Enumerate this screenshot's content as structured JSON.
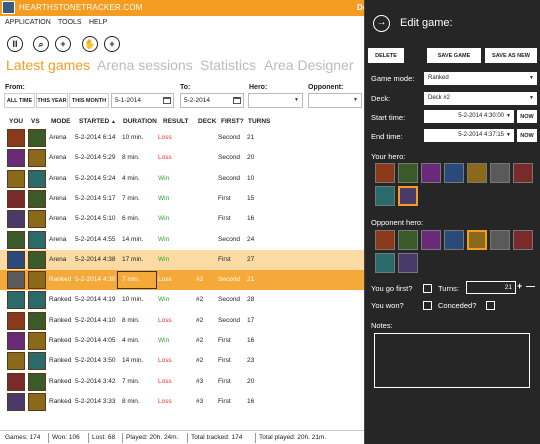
{
  "app": {
    "title": "HEARTHSTONETRACKER.COM",
    "donate": "Donate",
    "icon": "hearthstone-logo"
  },
  "titlebar_buttons": [
    "gear-icon",
    "notification-icon",
    "info-icon",
    "minimize-icon",
    "maximize-icon",
    "close-icon"
  ],
  "menu": [
    "APPLICATION",
    "TOOLS",
    "HELP"
  ],
  "toolbar": [
    "pause-icon",
    "search-icon",
    "add-icon",
    "glove-icon",
    "add-icon"
  ],
  "tabs": [
    "Latest games",
    "Arena sessions",
    "Statistics",
    "Area Designer"
  ],
  "filters": {
    "from_label": "From:",
    "to_label": "To:",
    "hero_label": "Hero:",
    "opponent_label": "Opponent:",
    "all_time": "ALL TIME",
    "this_year": "THIS YEAR",
    "this_month": "THIS MONTH",
    "from_date": "5-1-2014",
    "to_date": "5-2-2014",
    "hero_value": "",
    "opponent_value": ""
  },
  "columns": [
    "YOU",
    "VS",
    "MODE",
    "STARTED",
    "DURATION",
    "RESULT",
    "DECK",
    "FIRST?",
    "TURNS"
  ],
  "sort_indicator": "▲",
  "games": [
    {
      "mode": "Arena",
      "started": "5-2-2014 6:14",
      "duration": "10 min.",
      "result": "Loss",
      "deck": "",
      "first": "Second",
      "turns": "21"
    },
    {
      "mode": "Arena",
      "started": "5-2-2014 5:29",
      "duration": "8 min.",
      "result": "Loss",
      "deck": "",
      "first": "Second",
      "turns": "20"
    },
    {
      "mode": "Arena",
      "started": "5-2-2014 5:24",
      "duration": "4 min.",
      "result": "Win",
      "deck": "",
      "first": "Second",
      "turns": "10"
    },
    {
      "mode": "Arena",
      "started": "5-2-2014 5:17",
      "duration": "7 min.",
      "result": "Win",
      "deck": "",
      "first": "First",
      "turns": "15"
    },
    {
      "mode": "Arena",
      "started": "5-2-2014 5:10",
      "duration": "6 min.",
      "result": "Win",
      "deck": "",
      "first": "First",
      "turns": "16"
    },
    {
      "mode": "Arena",
      "started": "5-2-2014 4:55",
      "duration": "14 min.",
      "result": "Win",
      "deck": "",
      "first": "Second",
      "turns": "24"
    },
    {
      "mode": "Arena",
      "started": "5-2-2014 4:38",
      "duration": "17 min.",
      "result": "Win",
      "deck": "",
      "first": "First",
      "turns": "27"
    },
    {
      "mode": "Ranked",
      "started": "5-2-2014 4:30",
      "duration": "7 min.",
      "result": "Loss",
      "deck": "#2",
      "first": "Second",
      "turns": "21"
    },
    {
      "mode": "Ranked",
      "started": "5-2-2014 4:19",
      "duration": "10 min.",
      "result": "Win",
      "deck": "#2",
      "first": "Second",
      "turns": "28"
    },
    {
      "mode": "Ranked",
      "started": "5-2-2014 4:10",
      "duration": "8 min.",
      "result": "Loss",
      "deck": "#2",
      "first": "Second",
      "turns": "17"
    },
    {
      "mode": "Ranked",
      "started": "5-2-2014 4:05",
      "duration": "4 min.",
      "result": "Win",
      "deck": "#2",
      "first": "First",
      "turns": "16"
    },
    {
      "mode": "Ranked",
      "started": "5-2-2014 3:50",
      "duration": "14 min.",
      "result": "Loss",
      "deck": "#2",
      "first": "First",
      "turns": "23"
    },
    {
      "mode": "Ranked",
      "started": "5-2-2014 3:42",
      "duration": "7 min.",
      "result": "Loss",
      "deck": "#3",
      "first": "First",
      "turns": "20"
    },
    {
      "mode": "Ranked",
      "started": "5-2-2014 3:33",
      "duration": "8 min.",
      "result": "Loss",
      "deck": "#3",
      "first": "First",
      "turns": "16"
    }
  ],
  "status": {
    "games": "Games: 174",
    "won": "Won: 106",
    "lost": "Lost: 68",
    "played": "Played: 20h. 24m.",
    "total_tracked": "Total tracked: 174",
    "total_played": "Total played: 20h. 21m."
  },
  "panel": {
    "title": "Edit game:",
    "delete": "DELETE",
    "save_game": "SAVE GAME",
    "save_as_new": "SAVE AS NEW",
    "game_mode_label": "Game mode:",
    "game_mode": "Ranked",
    "deck_label": "Deck:",
    "deck": "Deck #2",
    "start_label": "Start time:",
    "start_time": "5-2-2014 4:30:00",
    "end_label": "End time:",
    "end_time": "5-2-2014 4:37:15",
    "now": "NOW",
    "your_hero_label": "Your hero:",
    "opponent_hero_label": "Opponent hero:",
    "go_first_label": "You go first?",
    "turns_label": "Turns:",
    "turns_value": "21",
    "won_label": "You won?",
    "conceded_label": "Conceded?",
    "notes_label": "Notes:"
  },
  "colors": {
    "accent": "#f39c1f",
    "panel": "#262626",
    "win": "#2ea52e",
    "loss": "#ee3333",
    "selected_row": "#fbdba3",
    "current_row": "#f5a938"
  }
}
